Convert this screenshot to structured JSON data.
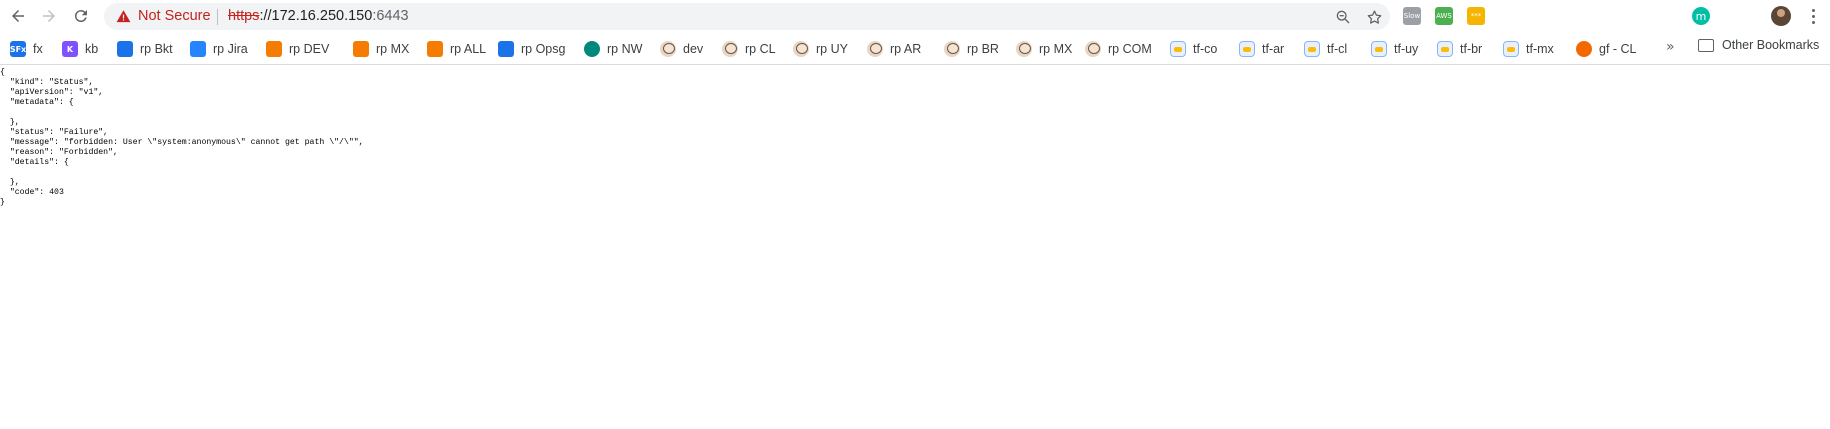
{
  "toolbar": {
    "security_label": "Not Secure",
    "url": {
      "scheme": "https",
      "host": "://172.16.250.150",
      "port": ":6443"
    },
    "extensions": [
      {
        "name": "slow-extension-icon",
        "text": "Slow",
        "color": "#9aa0a6"
      },
      {
        "name": "aws-extension-icon",
        "text": "AWS",
        "color": "#4caf50"
      },
      {
        "name": "password-extension-icon",
        "text": "***",
        "color": "#f4b400"
      },
      {
        "name": "eye-extension-icon",
        "text": "",
        "color": "#ffffff"
      },
      {
        "name": "incognito-extension-icon",
        "text": "",
        "color": "#ffffff"
      },
      {
        "name": "gear-extension-icon",
        "text": "",
        "color": "#ffffff"
      },
      {
        "name": "puzzle-extension-icon",
        "text": "",
        "color": "#ffffff"
      },
      {
        "name": "gnome-extension-icon",
        "text": "",
        "color": "#ffffff"
      },
      {
        "name": "circle-extension-icon",
        "text": "",
        "color": "#ffffff"
      },
      {
        "name": "m-extension-icon",
        "text": "m",
        "color": "#00bfa5"
      },
      {
        "name": "arrows-extension-icon",
        "text": "",
        "color": "#ffffff"
      }
    ]
  },
  "bookmarks": [
    {
      "label": "fx",
      "icon": "sfx-icon",
      "color": "#1a73e8",
      "glyph": "SFx"
    },
    {
      "label": "kb",
      "icon": "kotlin-icon",
      "color": "#7f52ff",
      "glyph": "K"
    },
    {
      "label": "rp Bkt",
      "icon": "bitbucket-icon",
      "color": "#1a73e8",
      "glyph": ""
    },
    {
      "label": "rp Jira",
      "icon": "jira-icon",
      "color": "#2684ff",
      "glyph": ""
    },
    {
      "label": "rp DEV",
      "icon": "cube-icon",
      "color": "#f57c00",
      "glyph": ""
    },
    {
      "label": "rp MX",
      "icon": "cube-icon",
      "color": "#f57c00",
      "glyph": ""
    },
    {
      "label": "rp ALL",
      "icon": "cube-icon",
      "color": "#f57c00",
      "glyph": ""
    },
    {
      "label": "rp Opsg",
      "icon": "opsgenie-icon",
      "color": "#1a73e8",
      "glyph": ""
    },
    {
      "label": "rp NW",
      "icon": "ring-icon",
      "color": "#00897b",
      "glyph": ""
    },
    {
      "label": "dev",
      "icon": "jenkins-icon",
      "color": "",
      "glyph": ""
    },
    {
      "label": "rp CL",
      "icon": "jenkins-icon",
      "color": "",
      "glyph": ""
    },
    {
      "label": "rp UY",
      "icon": "jenkins-icon",
      "color": "",
      "glyph": ""
    },
    {
      "label": "rp AR",
      "icon": "jenkins-icon",
      "color": "",
      "glyph": ""
    },
    {
      "label": "rp BR",
      "icon": "jenkins-icon",
      "color": "",
      "glyph": ""
    },
    {
      "label": "rp MX",
      "icon": "jenkins-icon",
      "color": "",
      "glyph": ""
    },
    {
      "label": "rp COM",
      "icon": "jenkins-icon",
      "color": "",
      "glyph": ""
    },
    {
      "label": "tf-co",
      "icon": "tf-icon",
      "color": "",
      "glyph": ""
    },
    {
      "label": "tf-ar",
      "icon": "tf-icon",
      "color": "",
      "glyph": ""
    },
    {
      "label": "tf-cl",
      "icon": "tf-icon",
      "color": "",
      "glyph": ""
    },
    {
      "label": "tf-uy",
      "icon": "tf-icon",
      "color": "",
      "glyph": ""
    },
    {
      "label": "tf-br",
      "icon": "tf-icon",
      "color": "",
      "glyph": ""
    },
    {
      "label": "tf-mx",
      "icon": "tf-icon",
      "color": "",
      "glyph": ""
    },
    {
      "label": "gf - CL",
      "icon": "grafana-icon",
      "color": "#f46800",
      "glyph": ""
    }
  ],
  "bookmarks_more": "»",
  "other_bookmarks": "Other Bookmarks",
  "page": {
    "lines": [
      "{",
      "  \"kind\": \"Status\",",
      "  \"apiVersion\": \"v1\",",
      "  \"metadata\": {",
      "",
      "  },",
      "  \"status\": \"Failure\",",
      "  \"message\": \"forbidden: User \\\"system:anonymous\\\" cannot get path \\\"/\\\"\",",
      "  \"reason\": \"Forbidden\",",
      "  \"details\": {",
      "",
      "  },",
      "  \"code\": 403",
      "}"
    ]
  }
}
